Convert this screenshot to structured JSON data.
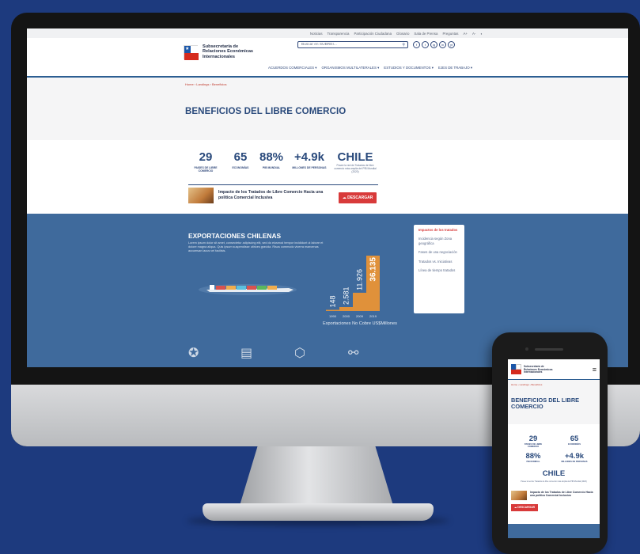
{
  "topbar": {
    "links": [
      "Noticias",
      "Transparencia",
      "Participación Ciudadana",
      "Glosario",
      "Sala de Prensa",
      "Preguntas",
      "A+",
      "A-"
    ]
  },
  "header": {
    "org_line1": "Subsecretaría de",
    "org_line2": "Relaciones Económicas",
    "org_line3": "Internacionales",
    "search_placeholder": "Buscar en SUBREI...",
    "socials": [
      "f",
      "t",
      "ig",
      "in",
      "yt"
    ],
    "menu": [
      "ACUERDOS COMERCIALES ▾",
      "ORGANISMOS MULTILATERALES ▾",
      "ESTUDIOS Y DOCUMENTOS ▾",
      "EJES DE TRABAJO ▾"
    ]
  },
  "hero": {
    "breadcrumb": "Home › Landings › Beneficios",
    "title": "BENEFICIOS DEL LIBRE COMERCIO"
  },
  "stats": [
    {
      "num": "29",
      "label": "PAISES DE LIBRE COMERCIO"
    },
    {
      "num": "65",
      "label": "ECONOMÍAS"
    },
    {
      "num": "88%",
      "label": "PIB MUNDIAL"
    },
    {
      "num": "+4.9k",
      "label": "MILLONES DE PERSONAS"
    },
    {
      "num": "CHILE",
      "label": "Posee la red de Tratados de libre comercio más amplia del PIB Mundial (2020)"
    }
  ],
  "report": {
    "title": "Impacto de los Tratados de Libre Comercio Hacia una política Comercial Inclusiva",
    "button": "DESCARGAR"
  },
  "exports": {
    "title": "EXPORTACIONES CHILENAS",
    "text": "Lorem ipsum dolor sit amet, consectetur adipiscing elit, sed do eiusmod tempor incididunt ut labore et dolore magna aliqua. Quis ipsum suspendisse ultrices gravida. Risus commodo viverra maecenas accumsan lacus vel facilisis.",
    "caption": "Exportaciones No Cobre US$Millones"
  },
  "side_menu": [
    {
      "label": "Impactos de los tratados",
      "active": true
    },
    {
      "label": "Incidencia según Zona geográfica",
      "active": false
    },
    {
      "label": "Fases de una negociación",
      "active": false
    },
    {
      "label": "Tratados vs. Iniciativas",
      "active": false
    },
    {
      "label": "Línea de tiempo tratados",
      "active": false
    }
  ],
  "chart_data": {
    "type": "bar",
    "categories": [
      "1990",
      "2000",
      "2009",
      "2019"
    ],
    "values": [
      148,
      2581,
      11926,
      36135
    ],
    "value_labels": [
      "148",
      "2.581",
      "11.926",
      "36.135"
    ],
    "ylim": [
      0,
      36135
    ],
    "bar_color": "#e0913a",
    "xlabel": "Exportaciones No Cobre US$Millones"
  },
  "phone": {
    "org_lines": [
      "Subsecretaría de",
      "Relaciones Económicas",
      "Internacionales"
    ],
    "breadcrumb": "Home › Landings › Beneficios",
    "title": "BENEFICIOS DEL LIBRE COMERCIO",
    "stats": [
      {
        "num": "29",
        "label": "PAISES DE LIBRE COMERCIO"
      },
      {
        "num": "65",
        "label": "ECONOMÍAS"
      },
      {
        "num": "88%",
        "label": "PIB MUNDIAL"
      },
      {
        "num": "+4.9k",
        "label": "MILLONES DE PERSONAS"
      },
      {
        "num": "CHILE",
        "label": "Posee la red de Tratados de libre comercio más amplia del PIB Mundial (2020)"
      }
    ],
    "report_title": "Impacto de los Tratados de Libre Comercio Hacia una política Comercial Inclusiva",
    "button": "DESCARGAR"
  },
  "colors": {
    "background": "#1d3a7e",
    "brand_blue": "#2a4a7c",
    "section_blue": "#3f6a9c",
    "accent_red": "#d83a3a",
    "bar_orange": "#e0913a"
  }
}
